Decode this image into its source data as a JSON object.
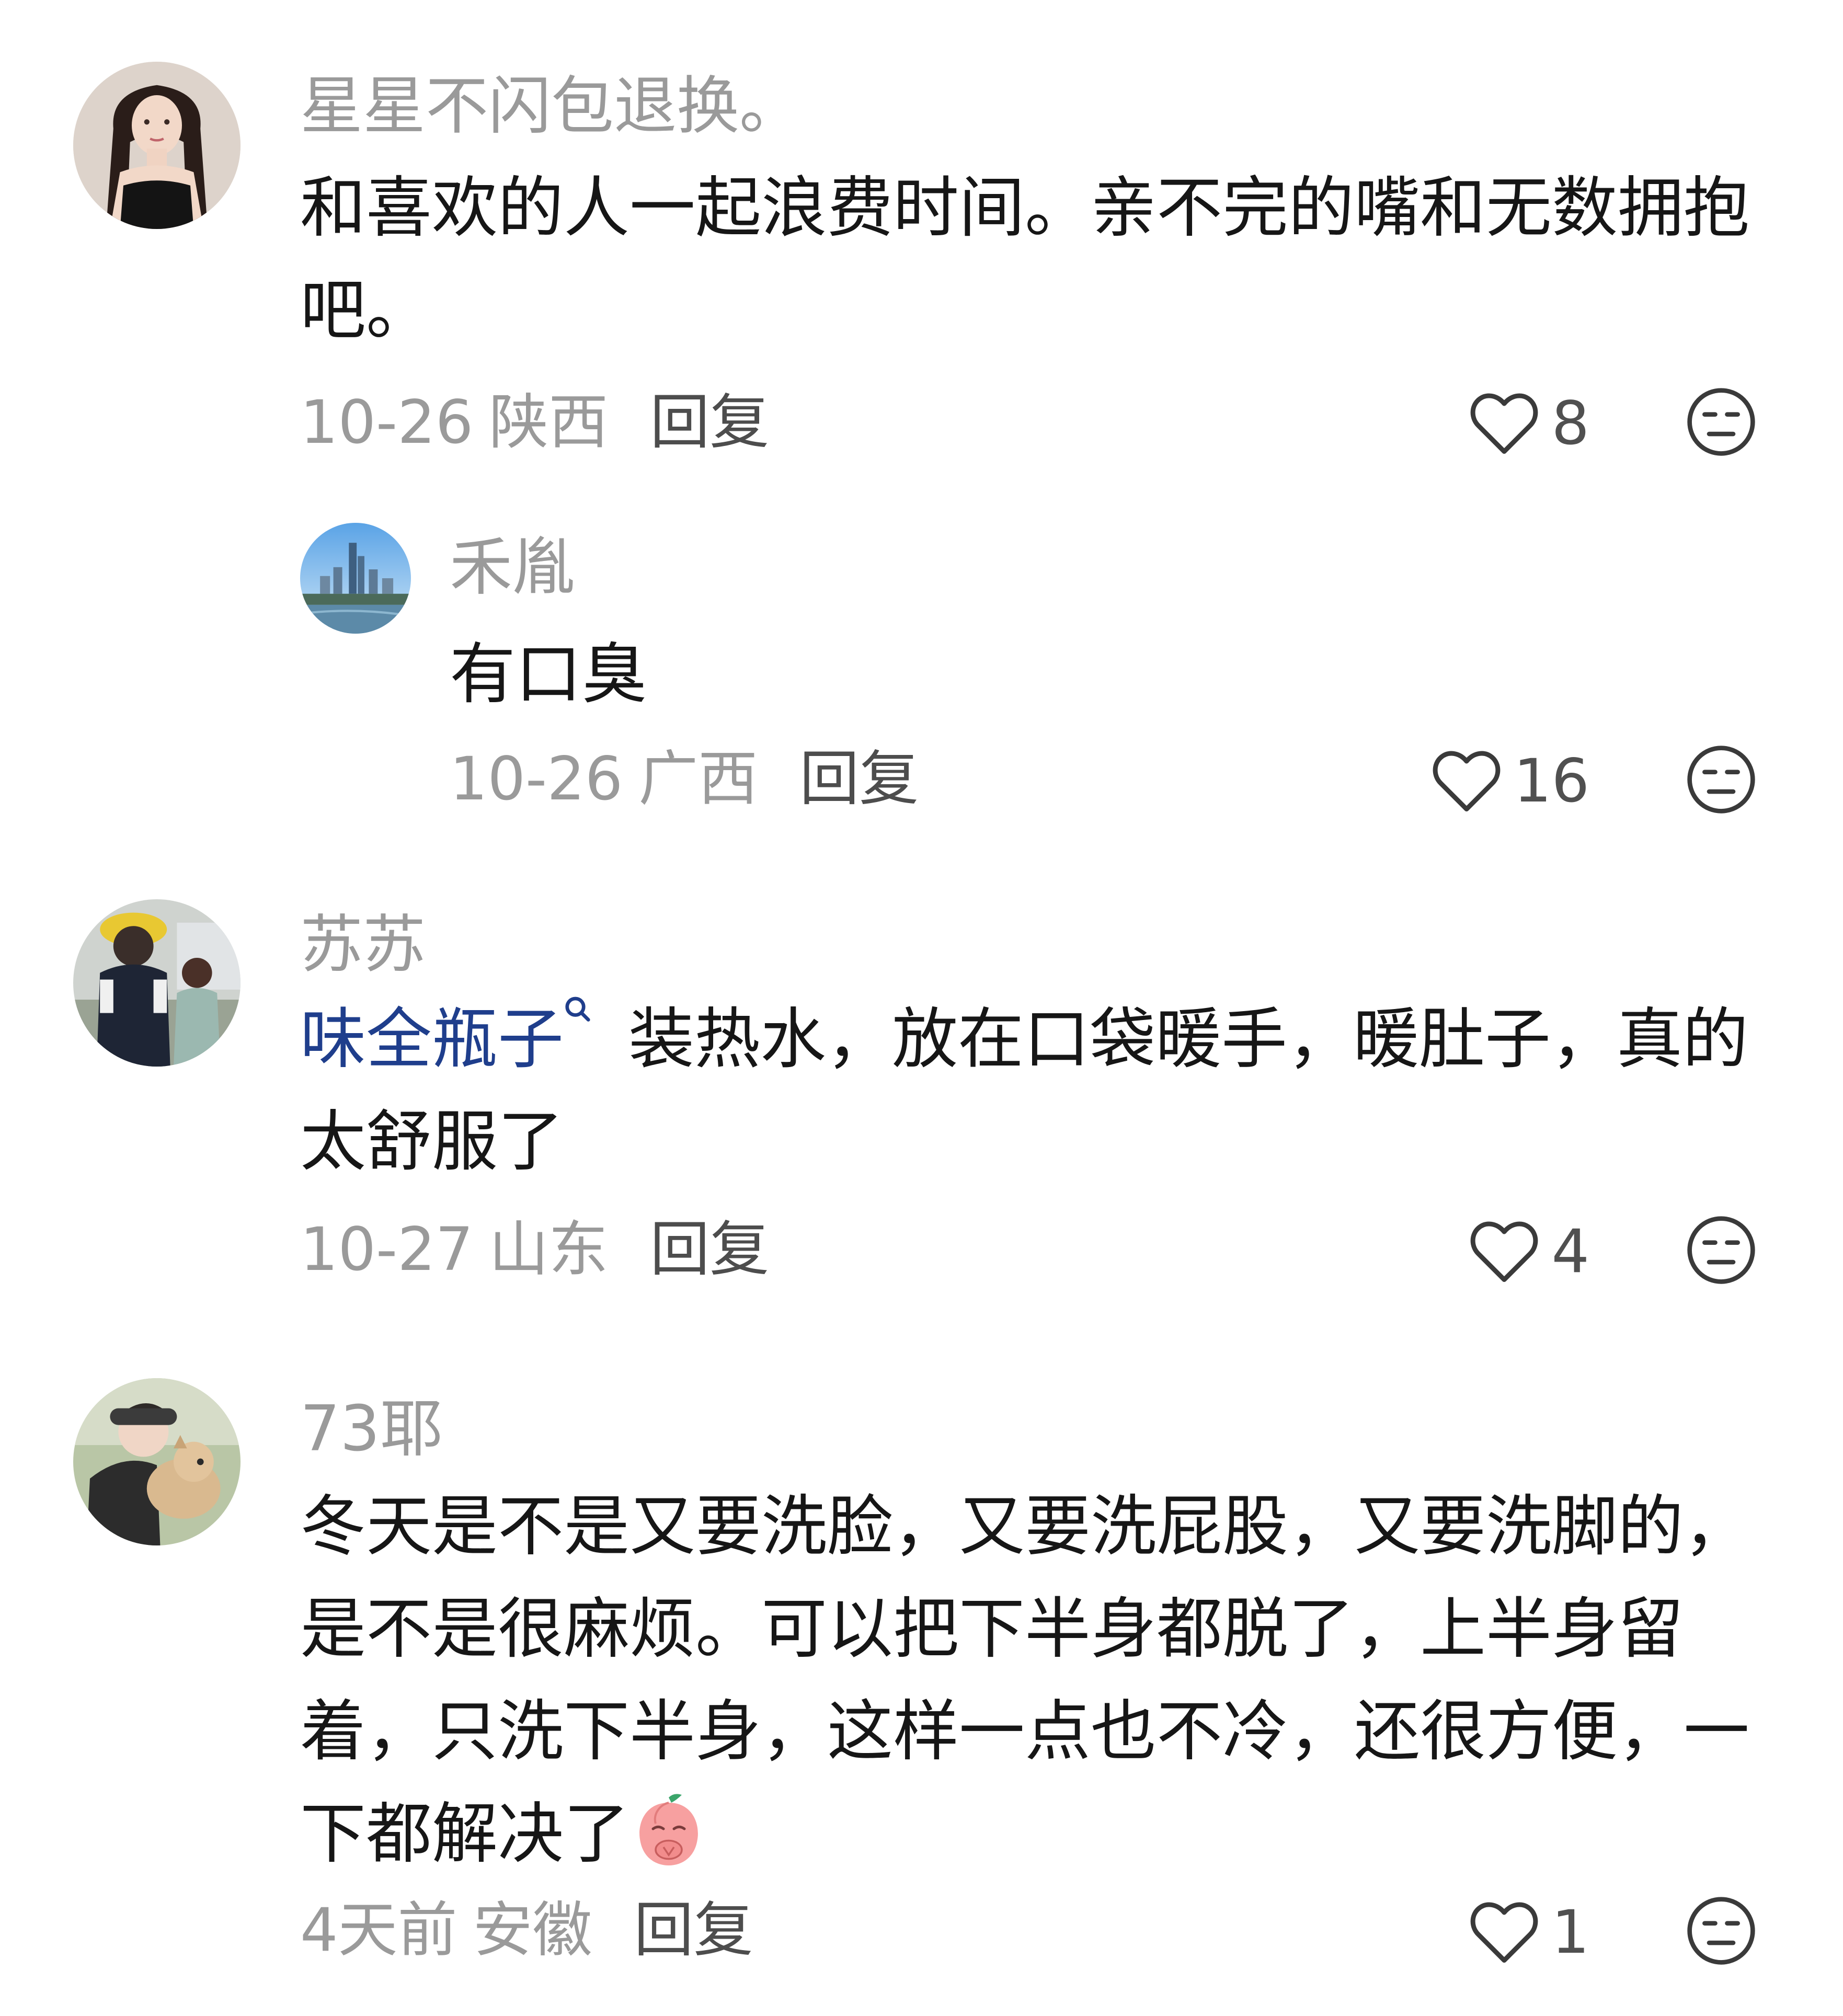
{
  "comments": [
    {
      "username": "星星不闪包退换。",
      "text": "和喜欢的人一起浪费时间。亲不完的嘴和无数拥抱吧。",
      "date": "10-26",
      "location": "陕西",
      "reply_label": "回复",
      "likes": "8",
      "avatar_icon": "avatar-woman-braids",
      "replies": [
        {
          "username": "禾胤",
          "text": "有口臭",
          "date": "10-26",
          "location": "广西",
          "reply_label": "回复",
          "likes": "16",
          "avatar_icon": "avatar-city-skyline"
        }
      ]
    },
    {
      "username": "苏苏",
      "mention": "味全瓶子",
      "text": "装热水，放在口袋暖手，暖肚子，真的太舒服了",
      "date": "10-27",
      "location": "山东",
      "reply_label": "回复",
      "likes": "4",
      "avatar_icon": "avatar-two-kids"
    },
    {
      "username": "73耶",
      "text": "冬天是不是又要洗脸，又要洗屁股，又要洗脚的，是不是很麻烦。可以把下半身都脱了，上半身留着，只洗下半身，这样一点也不冷，还很方便，一下都解决了",
      "emoji": "peach-pray-emoji",
      "date": "4天前",
      "location": "安徽",
      "reply_label": "回复",
      "likes": "1",
      "avatar_icon": "avatar-person-with-dog"
    }
  ],
  "icons": {
    "like": "heart-outline-icon",
    "dislike": "unamused-face-icon"
  },
  "colors": {
    "username": "#9a9a9a",
    "text": "#161616",
    "mention": "#1f3e8c",
    "meta": "#9a9a9a",
    "reply": "#4d4d4d"
  }
}
